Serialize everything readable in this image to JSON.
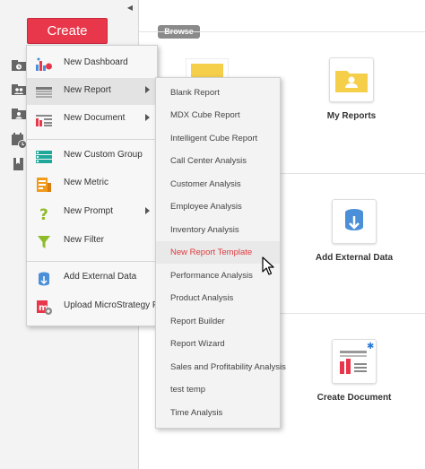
{
  "sidebar": {
    "create_label": "Create",
    "collapse_icon": "caret-left-icon",
    "icons": [
      "recent-icon",
      "shared-icon",
      "my-content-icon",
      "subscriptions-icon",
      "favorites-icon"
    ]
  },
  "main": {
    "browse_label": "Browse",
    "tiles": [
      {
        "label": "My Reports",
        "icon": "user-folder-icon"
      },
      {
        "label": "Add External Data",
        "icon": "database-import-icon"
      },
      {
        "label": "Create Document",
        "icon": "document-chart-icon"
      }
    ]
  },
  "create_menu": {
    "items": [
      {
        "label": "New Dashboard",
        "icon": "dashboard-icon"
      },
      {
        "label": "New Report",
        "icon": "grid-report-icon",
        "submenu": true
      },
      {
        "label": "New Document",
        "icon": "document-icon",
        "submenu": true
      },
      {
        "label": "New Custom Group",
        "icon": "custom-group-icon"
      },
      {
        "label": "New Metric",
        "icon": "metric-icon"
      },
      {
        "label": "New Prompt",
        "icon": "prompt-icon",
        "submenu": true
      },
      {
        "label": "New Filter",
        "icon": "filter-icon"
      },
      {
        "label": "Add External Data",
        "icon": "external-data-icon"
      },
      {
        "label": "Upload MicroStrategy File",
        "icon": "upload-file-icon"
      }
    ]
  },
  "report_submenu": {
    "items": [
      "Blank Report",
      "MDX Cube Report",
      "Intelligent Cube Report",
      "Call Center Analysis",
      "Customer Analysis",
      "Employee Analysis",
      "Inventory Analysis",
      "New Report Template",
      "Performance Analysis",
      "Product Analysis",
      "Report Builder",
      "Report Wizard",
      "Sales and Profitability Analysis",
      "test temp",
      "Time Analysis"
    ],
    "highlighted": "New Report Template"
  },
  "colors": {
    "accent": "#e8374a",
    "highlight_text": "#e03a3e",
    "folder": "#f5cf4a"
  }
}
